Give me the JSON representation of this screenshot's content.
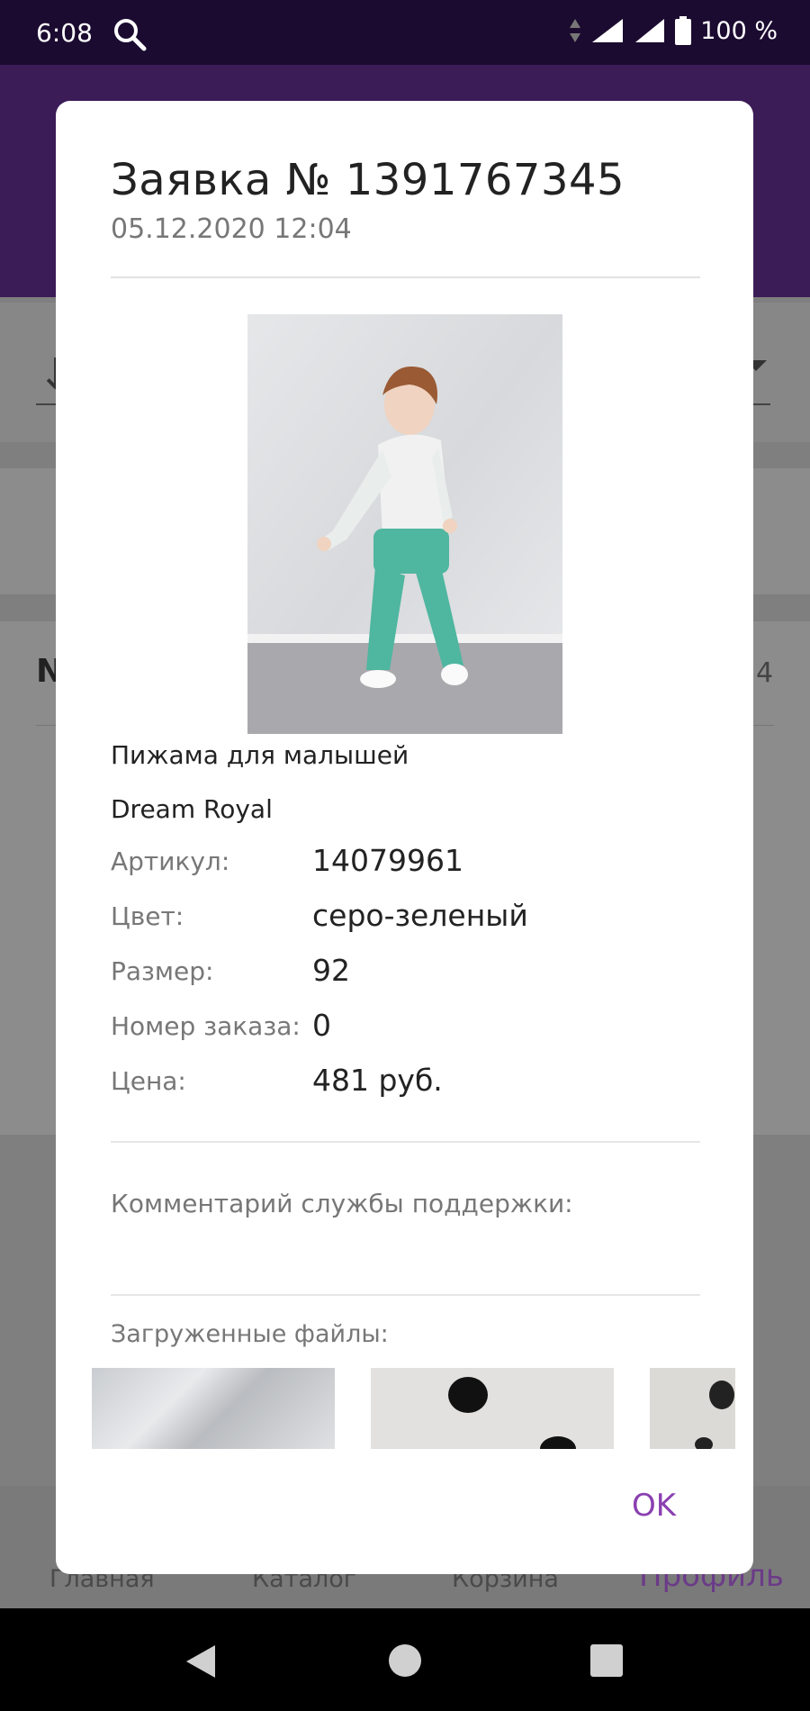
{
  "status_bar": {
    "time": "6:08",
    "battery": "100 %"
  },
  "background": {
    "nav": {
      "home": "Главная",
      "catalog": "Каталог",
      "cart": "Корзина",
      "profile": "Профиль"
    },
    "section_initial": "N",
    "side_count": "4"
  },
  "dialog": {
    "title": "Заявка № 1391767345",
    "date": "05.12.2020 12:04",
    "product_name": "Пижама для малышей",
    "brand": "Dream Royal",
    "fields": [
      {
        "label": "Артикул:",
        "value": "14079961"
      },
      {
        "label": "Цвет:",
        "value": "серо-зеленый"
      },
      {
        "label": "Размер:",
        "value": "92"
      },
      {
        "label": "Номер заказа:",
        "value": "0"
      },
      {
        "label": "Цена:",
        "value": "481 руб."
      }
    ],
    "support_comment_label": "Комментарий службы поддержки:",
    "uploaded_files_label": "Загруженные файлы:",
    "ok_label": "OK"
  },
  "colors": {
    "accent": "#8a3fb0",
    "status_bar": "#1c0b30",
    "app_bar": "#3b1c57"
  }
}
